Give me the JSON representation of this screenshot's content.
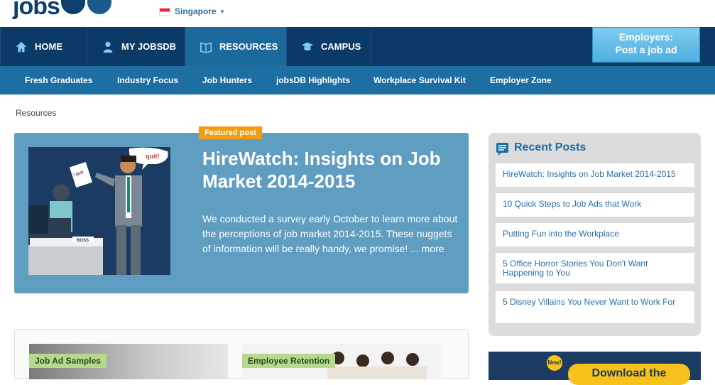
{
  "header": {
    "logo_text": "jobs",
    "country": "Singapore"
  },
  "nav": {
    "items": [
      {
        "label": "HOME",
        "icon": "home-icon"
      },
      {
        "label": "MY JOBSDB",
        "icon": "user-icon"
      },
      {
        "label": "RESOURCES",
        "icon": "book-icon",
        "active": true
      },
      {
        "label": "CAMPUS",
        "icon": "graduation-cap-icon"
      }
    ],
    "employers_line1": "Employers:",
    "employers_line2": "Post a job ad"
  },
  "subnav": {
    "items": [
      "Fresh Graduates",
      "Industry Focus",
      "Job Hunters",
      "jobsDB Highlights",
      "Workplace Survival Kit",
      "Employer Zone"
    ]
  },
  "breadcrumb": "Resources",
  "featured": {
    "tag": "Featured post",
    "title": "HireWatch: Insights on Job Market 2014-2015",
    "description": "We conducted a survey early October to learn more about the perceptions of job market 2014-2015. These nuggets of information will be really handy, we promise!",
    "more": "... more",
    "image_labels": {
      "quit": "I quit!",
      "boss": "BOSS"
    }
  },
  "cards": [
    {
      "tag": "Job Ad Samples"
    },
    {
      "tag": "Employee Retention"
    }
  ],
  "recent": {
    "title": "Recent Posts",
    "posts": [
      "HireWatch: Insights on Job Market 2014-2015",
      "10 Quick Steps to Job Ads that Work",
      "Putting Fun into the Workplace",
      "5 Office Horror Stories You Don't Want Happening to You",
      "5 Disney Villains You Never Want to Work For"
    ]
  },
  "promo": {
    "badge": "New!",
    "button": "Download the"
  },
  "colors": {
    "nav_dark": "#0c3a66",
    "subnav": "#1d6fa3",
    "featured_bg": "#5f9dc1",
    "featured_tag": "#f39c12",
    "card_tag": "#b6d98c"
  }
}
